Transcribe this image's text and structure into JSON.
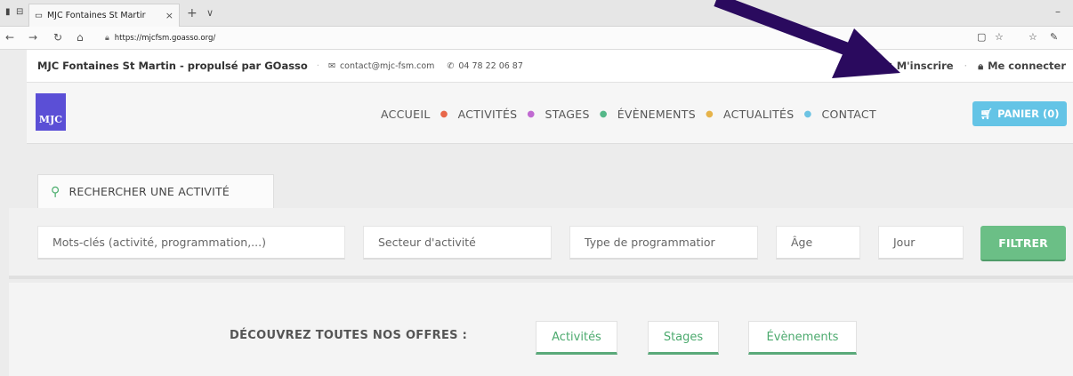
{
  "browser": {
    "tab_title": "MJC Fontaines St Martir",
    "tab_close": "×",
    "tab_new": "+",
    "tab_list": "∨",
    "url": "https://mjcfsm.goasso.org/"
  },
  "topbar": {
    "brand": "MJC Fontaines St Martin - propulsé par GOasso",
    "email": "contact@mjc-fsm.com",
    "phone": "04 78 22 06 87",
    "register": "M'inscrire",
    "login": "Me connecter"
  },
  "header": {
    "logo_text": "MJC",
    "menu": [
      "ACCUEIL",
      "ACTIVITÉS",
      "STAGES",
      "ÉVÈNEMENTS",
      "ACTUALITÉS",
      "CONTACT"
    ],
    "dot_colors": [
      "#e8674a",
      "#c06ad1",
      "#55b889",
      "#e6b34a",
      "#6cc3e3"
    ],
    "cart": "PANIER (0)"
  },
  "search": {
    "tab_label": "RECHERCHER UNE ACTIVITÉ",
    "keywords": "Mots-clés (activité, programmation,...)",
    "sector": "Secteur d'activité",
    "program_type": "Type de programmatior",
    "age": "Âge",
    "day": "Jour",
    "filter": "FILTRER"
  },
  "offers": {
    "label": "DÉCOUVREZ TOUTES NOS OFFRES :",
    "activities": "Activités",
    "stages": "Stages",
    "events": "Évènements"
  },
  "colors": {
    "accent_green": "#6bbf86",
    "cart_blue": "#64c4e6",
    "logo_purple": "#5b4fd6",
    "arrow": "#2a0a5e"
  }
}
